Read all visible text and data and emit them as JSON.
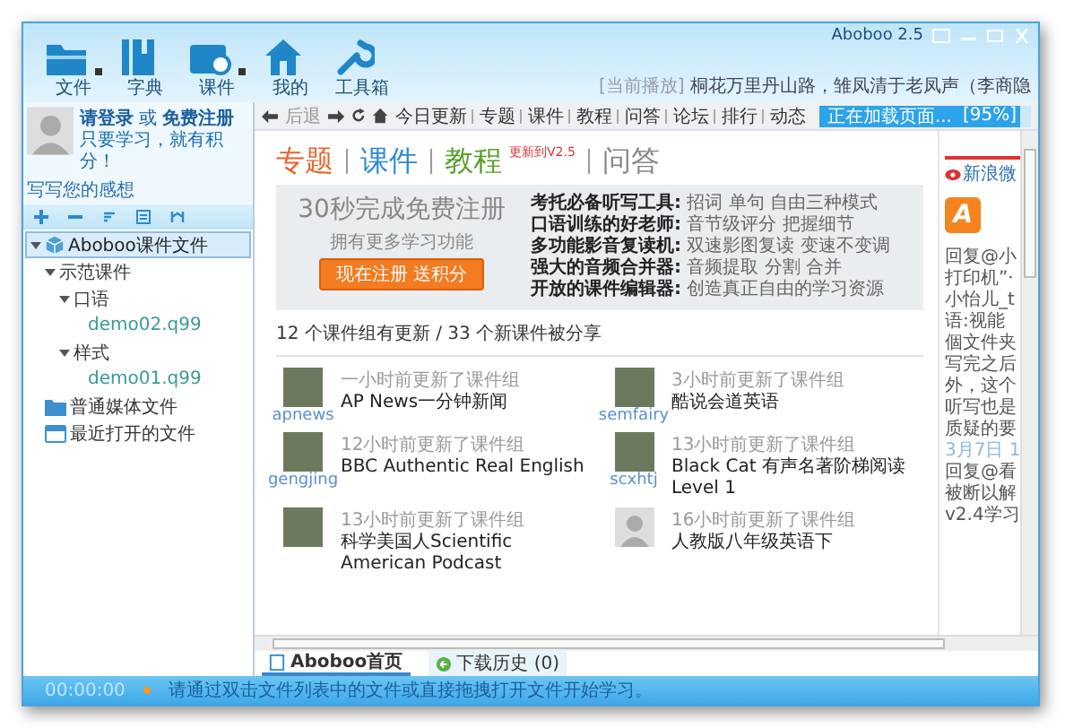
{
  "window": {
    "title": "Aboboo 2.5"
  },
  "toolbar": [
    {
      "label": "文件",
      "has_menu": true
    },
    {
      "label": "字典",
      "has_menu": false
    },
    {
      "label": "课件",
      "has_menu": true
    },
    {
      "label": "我的",
      "has_menu": false
    },
    {
      "label": "工具箱",
      "has_menu": false
    }
  ],
  "now_playing": {
    "label": "[当前播放]",
    "text": "桐花万里丹山路，雏凤清于老凤声（李商隐"
  },
  "user": {
    "login": "请登录",
    "or": "或",
    "register": "免费注册",
    "tagline": "只要学习，就有积分！",
    "note_link": "写写您的感想"
  },
  "tree": [
    {
      "label": "Aboboo课件文件",
      "kind": "root",
      "selected": true,
      "expanded": true,
      "children": [
        {
          "label": "示范课件",
          "kind": "folder",
          "selected": false,
          "expanded": true,
          "children": [
            {
              "label": "口语",
              "kind": "folder",
              "selected": false,
              "expanded": true,
              "children": [
                {
                  "label": "demo02.q99",
                  "kind": "file",
                  "selected": false
                }
              ]
            },
            {
              "label": "样式",
              "kind": "folder",
              "selected": false,
              "expanded": true,
              "children": [
                {
                  "label": "demo01.q99",
                  "kind": "file",
                  "selected": false
                }
              ]
            }
          ]
        }
      ]
    },
    {
      "label": "普通媒体文件",
      "kind": "media",
      "selected": false
    },
    {
      "label": "最近打开的文件",
      "kind": "recent",
      "selected": false
    }
  ],
  "nav": {
    "back": "后退",
    "links": [
      "今日更新",
      "专题",
      "课件",
      "教程",
      "问答",
      "论坛",
      "排行",
      "动态"
    ],
    "loading": {
      "text": "正在加载页面...",
      "percent": "[95%]",
      "level": 0.95
    }
  },
  "heading": [
    {
      "text": "专题",
      "color": "#e8642c"
    },
    {
      "text": "课件",
      "color": "#2a8ad0"
    },
    {
      "text": "教程",
      "color": "#5a9e2c",
      "badge": "更新到V2.5"
    },
    {
      "text": "问答",
      "color": "#888888"
    }
  ],
  "promo": {
    "title": "30秒完成免费注册",
    "subtitle": "拥有更多学习功能",
    "button": "现在注册",
    "button_extra": "送积分",
    "features": [
      {
        "name": "考托必备听写工具:",
        "desc": "招词 单句 自由三种模式"
      },
      {
        "name": "口语训练的好老师:",
        "desc": "音节级评分 把握细节"
      },
      {
        "name": "多功能影音复读机:",
        "desc": "双速影图复读 变速不变调"
      },
      {
        "name": "强大的音频合并器:",
        "desc": "音频提取 分割 合并"
      },
      {
        "name": "开放的课件编辑器:",
        "desc": "创造真正自由的学习资源"
      }
    ]
  },
  "stats": "12 个课件组有更新 / 33 个新课件被分享",
  "feed": [
    {
      "user": "apnews",
      "time": "一小时前更新了课件组",
      "title": "AP News一分钟新闻",
      "has_photo": true
    },
    {
      "user": "semfairy",
      "time": "3小时前更新了课件组",
      "title": "酷说会道英语",
      "has_photo": true
    },
    {
      "user": "gengjing",
      "time": "12小时前更新了课件组",
      "title": "BBC Authentic Real English",
      "has_photo": true
    },
    {
      "user": "scxhtj",
      "time": "13小时前更新了课件组",
      "title": "Black Cat 有声名著阶梯阅读 Level 1",
      "has_photo": true
    },
    {
      "time": "13小时前更新了课件组",
      "title": "科学美国人Scientific American Podcast",
      "has_photo": true
    },
    {
      "time": "16小时前更新了课件组",
      "title": "人教版八年级英语下",
      "has_photo": false
    }
  ],
  "weibo": {
    "title": "新浪微",
    "app_badge": "A",
    "lines": [
      "回复@小",
      "打印机”·",
      "小怡儿_t",
      "语:视能",
      "個文件夹",
      "写完之后",
      "外，这个",
      "听写也是",
      "质疑的要",
      "3月7日 1",
      "回复@看",
      "被断以解",
      "v2.4学习"
    ]
  },
  "tabs": [
    {
      "label": "Aboboo首页",
      "selected": true
    },
    {
      "label": "下载历史 (0)",
      "selected": false
    }
  ],
  "status": {
    "time": "00:00:00",
    "message": "请通过双击文件列表中的文件或直接拖拽打开文件开始学习。"
  }
}
